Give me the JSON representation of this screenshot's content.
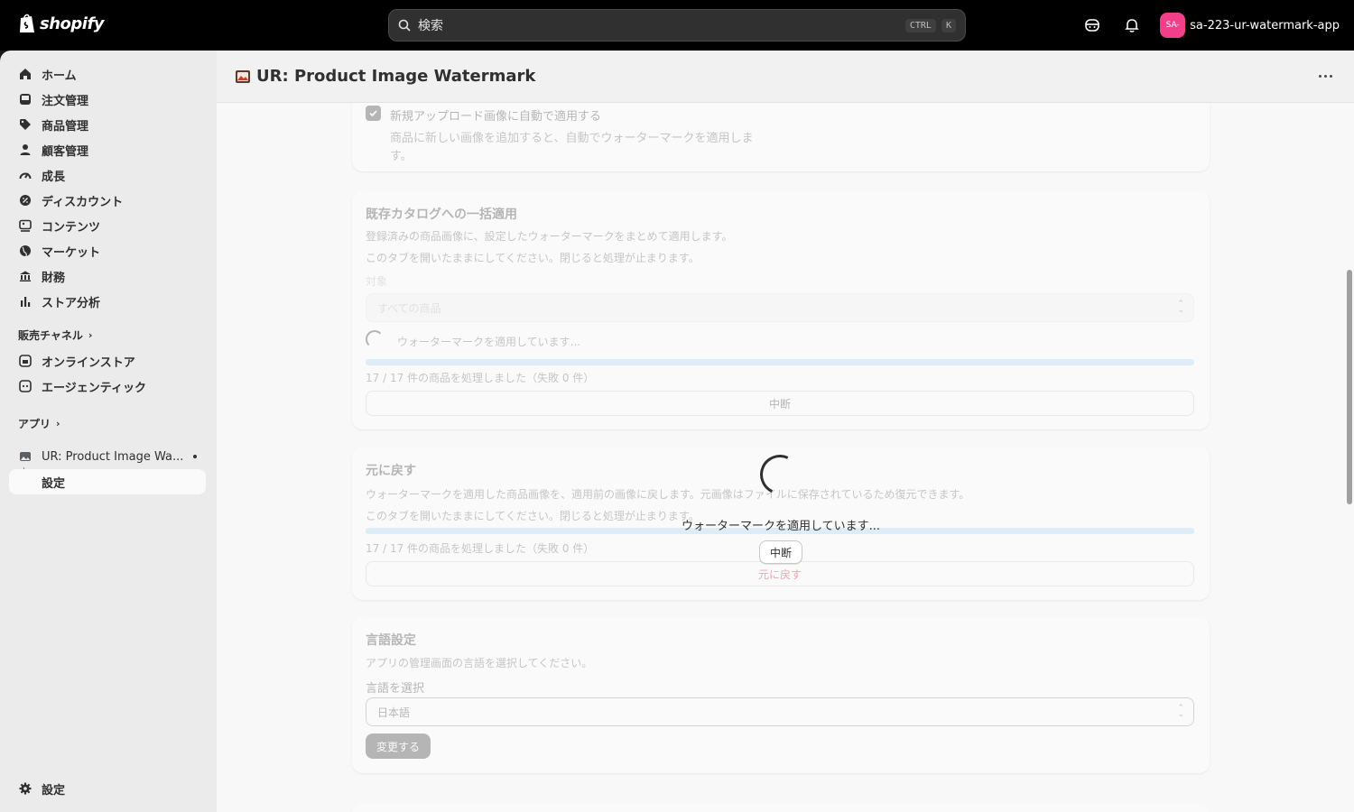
{
  "topbar": {
    "logo_text": "shopify",
    "search_placeholder": "検索",
    "shortcut_keys": [
      "CTRL",
      "K"
    ],
    "avatar_initials": "SA-",
    "store_name": "sa-223-ur-watermark-app"
  },
  "sidebar": {
    "items": [
      {
        "label": "ホーム"
      },
      {
        "label": "注文管理"
      },
      {
        "label": "商品管理"
      },
      {
        "label": "顧客管理"
      },
      {
        "label": "成長"
      },
      {
        "label": "ディスカウント"
      },
      {
        "label": "コンテンツ"
      },
      {
        "label": "マーケット"
      },
      {
        "label": "財務"
      },
      {
        "label": "ストア分析"
      }
    ],
    "sales_channels_label": "販売チャネル",
    "channels": [
      {
        "label": "オンラインストア"
      },
      {
        "label": "エージェンティック"
      }
    ],
    "apps_label": "アプリ",
    "app_item": "UR: Product Image Wa...",
    "app_sub_item": "設定",
    "settings_label": "設定"
  },
  "page": {
    "title": "UR: Product Image Watermark"
  },
  "auto_apply": {
    "checkbox_label": "新規アップロード画像に自動で適用する",
    "help_line1": "商品に新しい画像を追加すると、自動でウォーターマークを適用しま",
    "help_line2": "す。",
    "checked": true
  },
  "bulk_apply": {
    "title": "既存カタログへの一括適用",
    "description": "登録済みの商品画像に、設定したウォーターマークをまとめて適用します。",
    "tab_notice": "このタブを開いたままにしてください。閉じると処理が止まります。",
    "target_label": "対象",
    "target_value": "すべての商品",
    "status": "ウォーターマークを適用しています...",
    "progress_fraction": 1.0,
    "progress_text": "17 / 17 件の商品を処理しました（失敗 0 件）",
    "abort_label": "中断"
  },
  "restore": {
    "title": "元に戻す",
    "description": "ウォーターマークを適用した商品画像を、適用前の画像に戻します。元画像はファイルに保存されているため復元できます。",
    "tab_notice": "このタブを開いたままにしてください。閉じると処理が止まります。",
    "progress_fraction": 1.0,
    "progress_text": "17 / 17 件の商品を処理しました（失敗 0 件）",
    "button_label": "元に戻す"
  },
  "language": {
    "title": "言語設定",
    "description": "アプリの管理画面の言語を選択してください。",
    "select_label": "言語を選択",
    "select_value": "日本語",
    "button_label": "変更する"
  },
  "overlay": {
    "status": "ウォーターマークを適用しています...",
    "abort_label": "中断"
  },
  "colors": {
    "topbar": "#000000",
    "sidebar": "#ebebeb",
    "progress": "#a7d7f5",
    "critical": "#c70a24",
    "avatar": "#f13f8a"
  }
}
